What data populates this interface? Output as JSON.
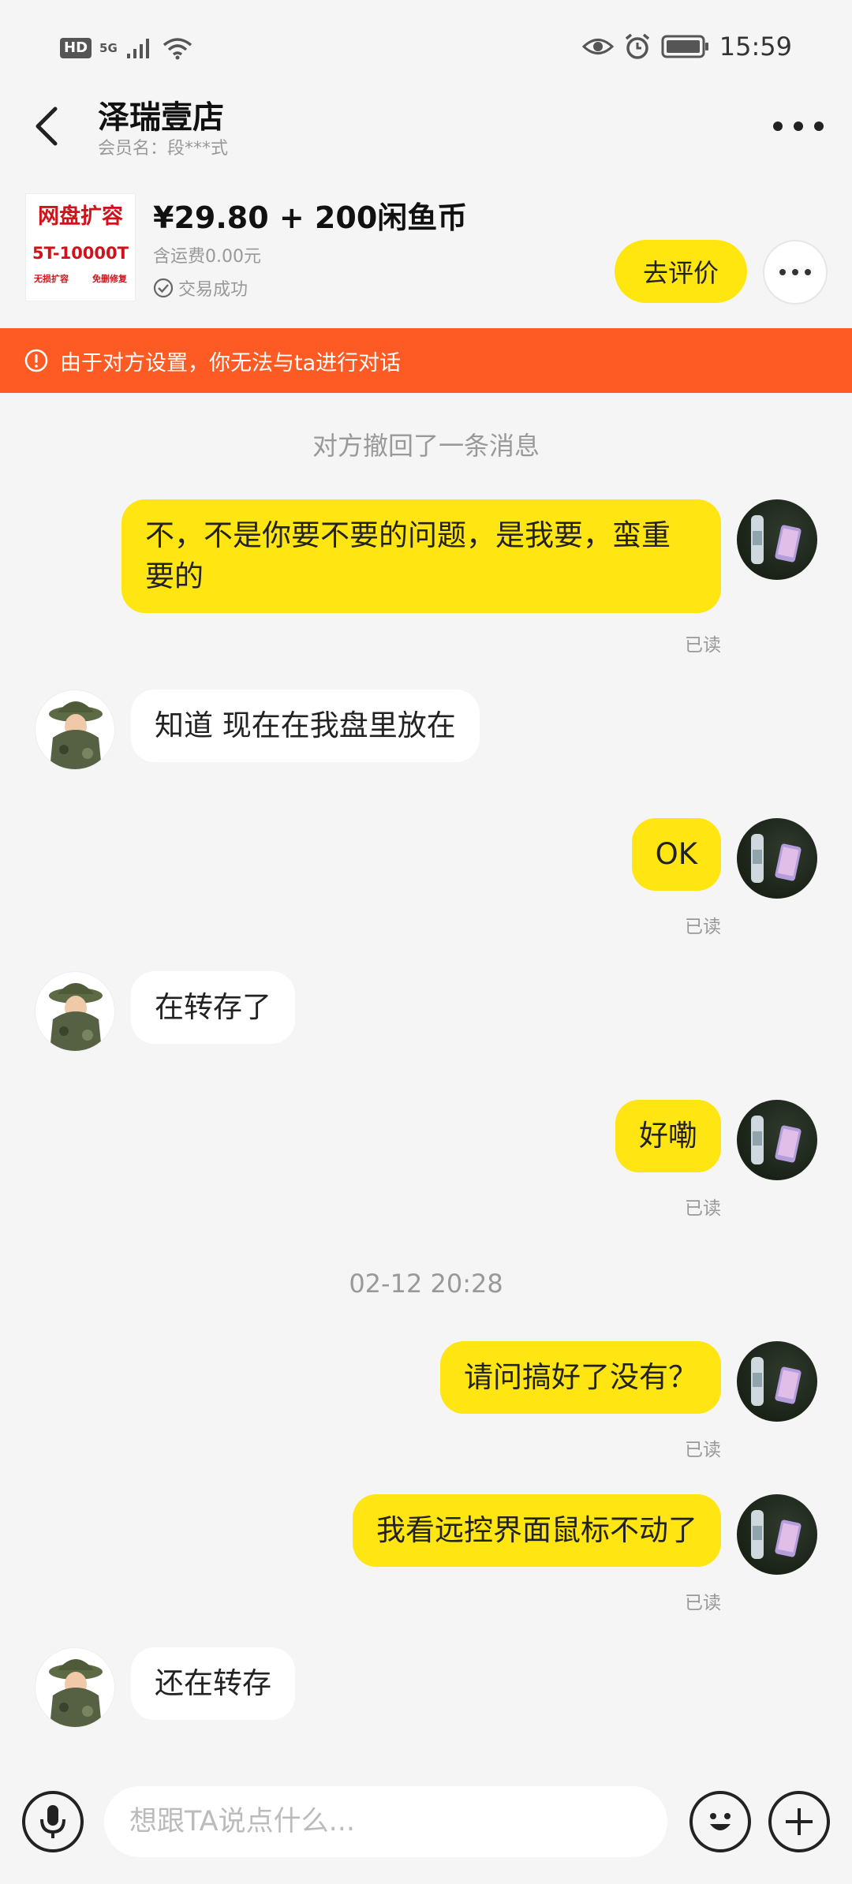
{
  "status_bar": {
    "hd": "HD",
    "network": "5G",
    "time": "15:59",
    "icons": [
      "signal-icon",
      "wifi-icon",
      "eye-icon",
      "alarm-icon",
      "battery-icon"
    ]
  },
  "header": {
    "title": "泽瑞壹店",
    "subtitle": "会员名：段***式"
  },
  "product": {
    "thumb_line1": "网盘扩容",
    "thumb_line2": "5T-10000T",
    "thumb_line3a": "无损扩容",
    "thumb_line3b": "免删修复",
    "price": "¥29.80 + 200闲鱼币",
    "shipping": "含运费0.00元",
    "status": "交易成功",
    "rate_button": "去评价"
  },
  "warning": "由于对方设置，你无法与ta进行对话",
  "chat": {
    "recalled_notice": "对方撤回了一条消息",
    "timestamp": "02-12 20:28",
    "read_label": "已读",
    "messages": [
      {
        "from": "me",
        "text": "不，不是你要不要的问题，是我要，蛮重要的",
        "read": "已读"
      },
      {
        "from": "other",
        "text": "知道 现在在我盘里放在"
      },
      {
        "from": "me",
        "text": "OK",
        "read": "已读"
      },
      {
        "from": "other",
        "text": "在转存了"
      },
      {
        "from": "me",
        "text": "好嘞",
        "read": "已读"
      },
      {
        "from": "me",
        "text": "请问搞好了没有？",
        "read": "已读"
      },
      {
        "from": "me",
        "text": "我看远控界面鼠标不动了",
        "read": "已读"
      },
      {
        "from": "other",
        "text": "还在转存"
      }
    ]
  },
  "input_bar": {
    "placeholder": "想跟TA说点什么..."
  },
  "colors": {
    "accent_yellow": "#ffe511",
    "warning_orange": "#fe5a23",
    "background": "#f5f5f5"
  }
}
